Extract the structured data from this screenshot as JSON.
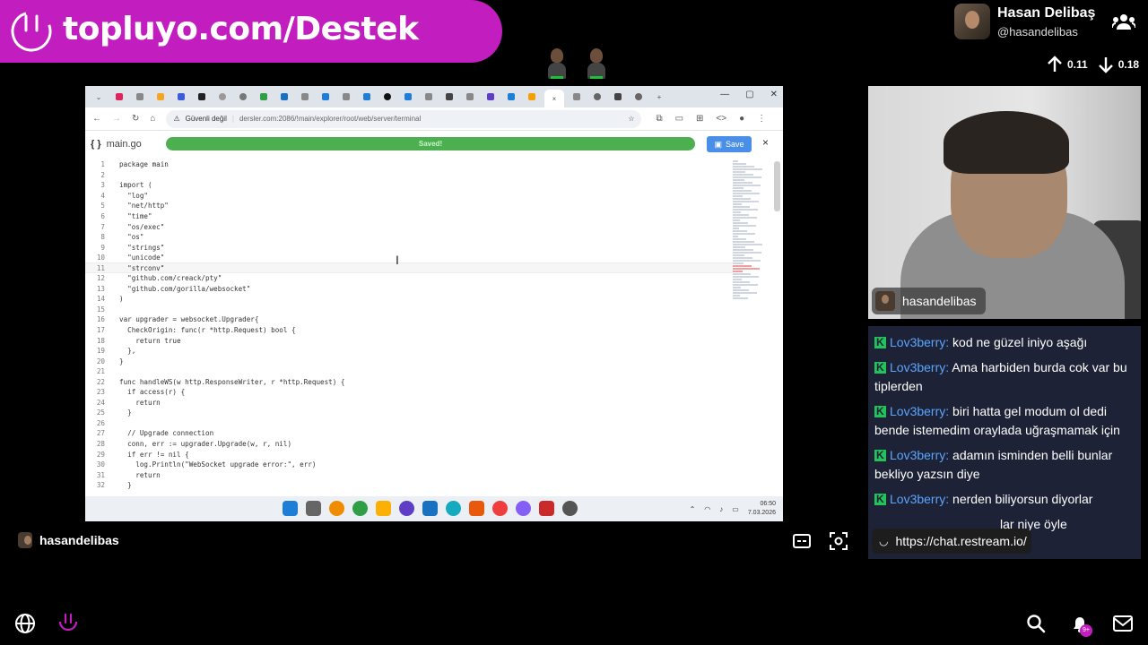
{
  "banner": {
    "url_text": "topluyo.com/Destek"
  },
  "profile": {
    "name": "Hasan Delibaş",
    "handle": "@hasandelibas"
  },
  "stats": {
    "up": "0.11",
    "down": "0.18"
  },
  "browser": {
    "tabs_count": 27,
    "address": {
      "security_label": "Güvenli değil",
      "url": "dersler.com:2086/!main/explorer/root/web/server/terminal"
    },
    "editor": {
      "file_name": "main.go",
      "file_icon": "{ }",
      "saved_text": "Saved!",
      "save_label": "Save",
      "close": "×"
    },
    "code_lines": [
      {
        "n": "1",
        "t": "package main"
      },
      {
        "n": "2",
        "t": ""
      },
      {
        "n": "3",
        "t": "import ("
      },
      {
        "n": "4",
        "t": "  \"log\""
      },
      {
        "n": "5",
        "t": "  \"net/http\""
      },
      {
        "n": "6",
        "t": "  \"time\""
      },
      {
        "n": "7",
        "t": "  \"os/exec\""
      },
      {
        "n": "8",
        "t": "  \"os\""
      },
      {
        "n": "9",
        "t": "  \"strings\""
      },
      {
        "n": "10",
        "t": "  \"unicode\""
      },
      {
        "n": "11",
        "t": "  \"strconv\""
      },
      {
        "n": "12",
        "t": "  \"github.com/creack/pty\""
      },
      {
        "n": "13",
        "t": "  \"github.com/gorilla/websocket\""
      },
      {
        "n": "14",
        "t": ")"
      },
      {
        "n": "15",
        "t": ""
      },
      {
        "n": "16",
        "t": "var upgrader = websocket.Upgrader{"
      },
      {
        "n": "17",
        "t": "  CheckOrigin: func(r *http.Request) bool {"
      },
      {
        "n": "18",
        "t": "    return true"
      },
      {
        "n": "19",
        "t": "  },"
      },
      {
        "n": "20",
        "t": "}"
      },
      {
        "n": "21",
        "t": ""
      },
      {
        "n": "22",
        "t": "func handleWS(w http.ResponseWriter, r *http.Request) {"
      },
      {
        "n": "23",
        "t": "  if access(r) {"
      },
      {
        "n": "24",
        "t": "    return"
      },
      {
        "n": "25",
        "t": "  }"
      },
      {
        "n": "26",
        "t": ""
      },
      {
        "n": "27",
        "t": "  // Upgrade connection"
      },
      {
        "n": "28",
        "t": "  conn, err := upgrader.Upgrade(w, r, nil)"
      },
      {
        "n": "29",
        "t": "  if err != nil {"
      },
      {
        "n": "30",
        "t": "    log.Println(\"WebSocket upgrade error:\", err)"
      },
      {
        "n": "31",
        "t": "    return"
      },
      {
        "n": "32",
        "t": "  }"
      }
    ],
    "taskbar": {
      "time": "06:50",
      "date": "7.03.2026"
    }
  },
  "cam": {
    "tag_name": "hasandelibas"
  },
  "chat": {
    "messages": [
      {
        "user": "Lov3berry:",
        "text": " kod ne güzel iniyo aşağı"
      },
      {
        "user": "Lov3berry:",
        "text": " Ama harbiden burda cok var bu tiplerden"
      },
      {
        "user": "Lov3berry:",
        "text": " biri hatta gel modum ol dedi bende istemedim oraylada uğraşmamak için"
      },
      {
        "user": "Lov3berry:",
        "text": " adamın isminden belli bunlar bekliyo yazsın diye"
      },
      {
        "user": "Lov3berry:",
        "text": " nerden biliyorsun diyorlar"
      },
      {
        "user": "",
        "text": "                                    lar niye öyle"
      }
    ],
    "link_popup": "https://chat.restream.io/"
  },
  "bottom": {
    "streamer_name": "hasandelibas",
    "badge": "9+"
  },
  "colors": {
    "brand": "#c21dbe",
    "chat_bg": "#1d2236",
    "chat_user": "#5aa6ff",
    "saved_green": "#4caf50",
    "save_blue": "#4a8fe7"
  }
}
